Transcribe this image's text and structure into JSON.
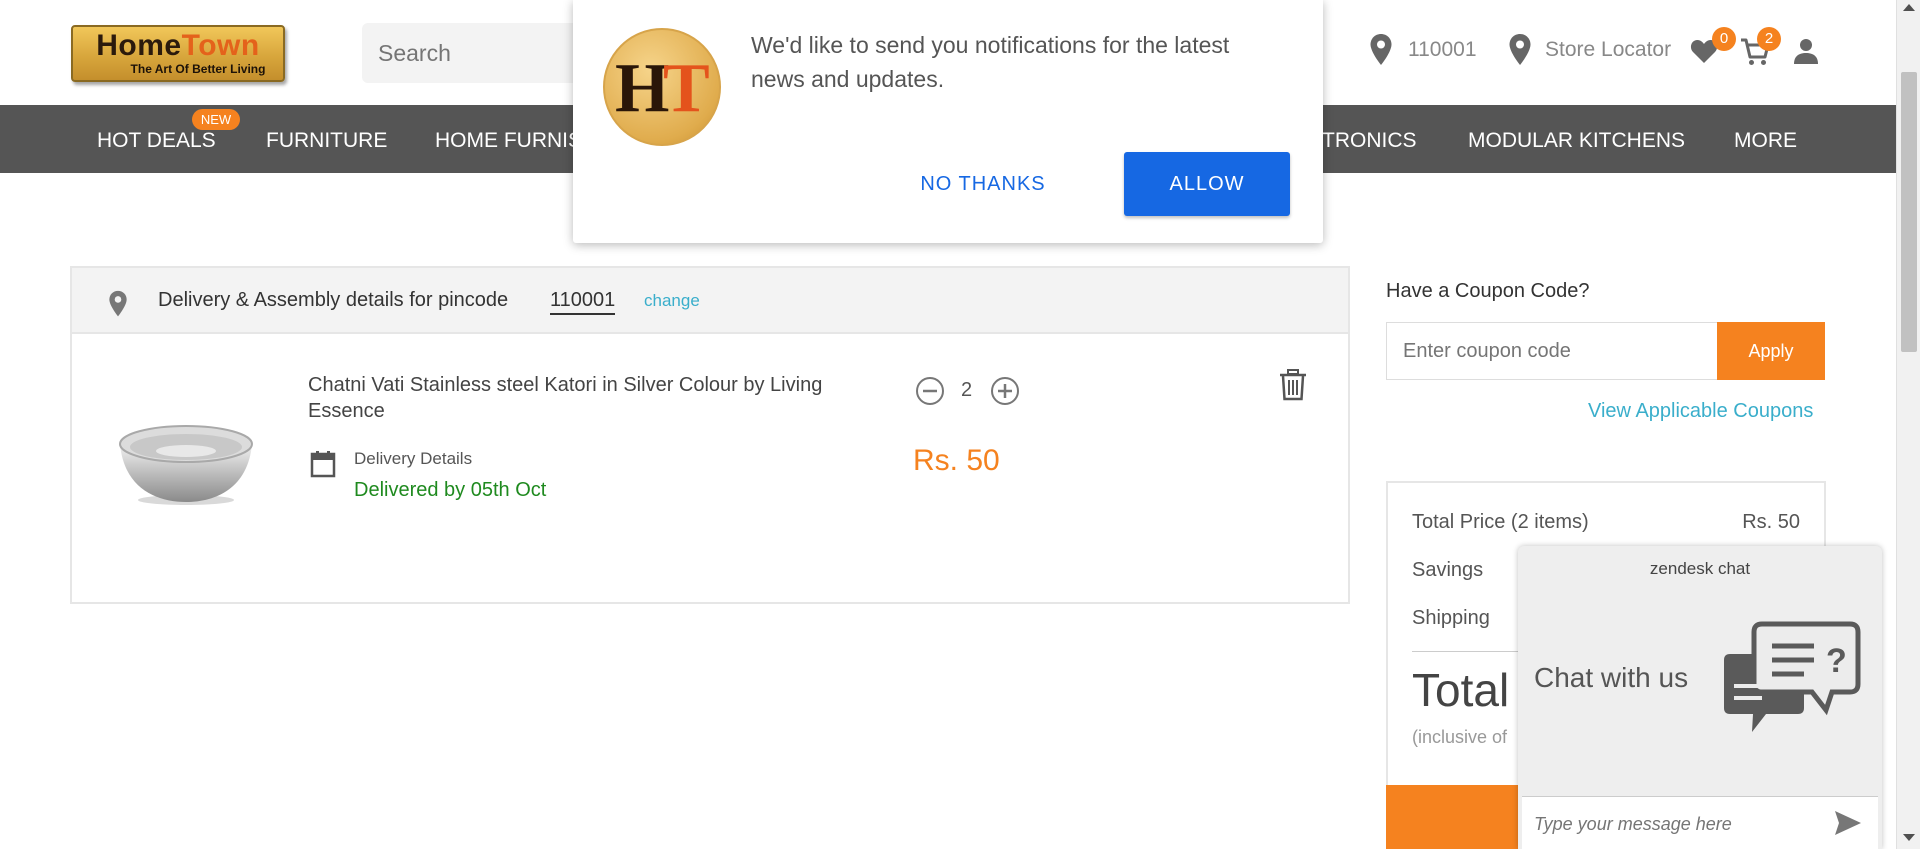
{
  "header": {
    "logo_text_1": "Home",
    "logo_text_2": "Town",
    "logo_tagline": "The Art Of Better Living",
    "search_placeholder": "Search",
    "pincode": "110001",
    "store_locator": "Store Locator",
    "wishlist_count": "0",
    "cart_count": "2"
  },
  "nav": {
    "items": [
      "HOT DEALS",
      "FURNITURE",
      "HOME FURNIS",
      "TRONICS",
      "MODULAR KITCHENS",
      "MORE"
    ],
    "new_badge": "NEW"
  },
  "notification": {
    "logo_h": "H",
    "logo_t": "T",
    "message": "We'd like to send you notifications for the latest news and updates.",
    "no_thanks": "NO THANKS",
    "allow": "ALLOW"
  },
  "cart": {
    "delivery_label": "Delivery & Assembly details for pincode",
    "pincode": "110001",
    "change": "change",
    "item": {
      "name": "Chatni Vati Stainless steel Katori in Silver Colour by Living Essence",
      "delivery_label": "Delivery Details",
      "delivery_date": "Delivered by 05th Oct",
      "quantity": "2",
      "price": "Rs. 50"
    }
  },
  "coupon": {
    "title": "Have a Coupon Code?",
    "placeholder": "Enter coupon code",
    "apply": "Apply",
    "view_link": "View Applicable Coupons"
  },
  "summary": {
    "total_price_label": "Total Price (2 items)",
    "total_price_value": "Rs. 50",
    "savings_label": "Savings",
    "shipping_label": "Shipping",
    "total_label": "Total",
    "inclusive_label": "(inclusive of"
  },
  "chat": {
    "brand": "zendesk chat",
    "title": "Chat with us",
    "placeholder": "Type your message here"
  },
  "colors": {
    "accent_orange": "#f5821f",
    "nav_bg": "#555555",
    "link_blue": "#3aaecb",
    "allow_blue": "#1668e3",
    "delivery_green": "#1f8a1f"
  }
}
